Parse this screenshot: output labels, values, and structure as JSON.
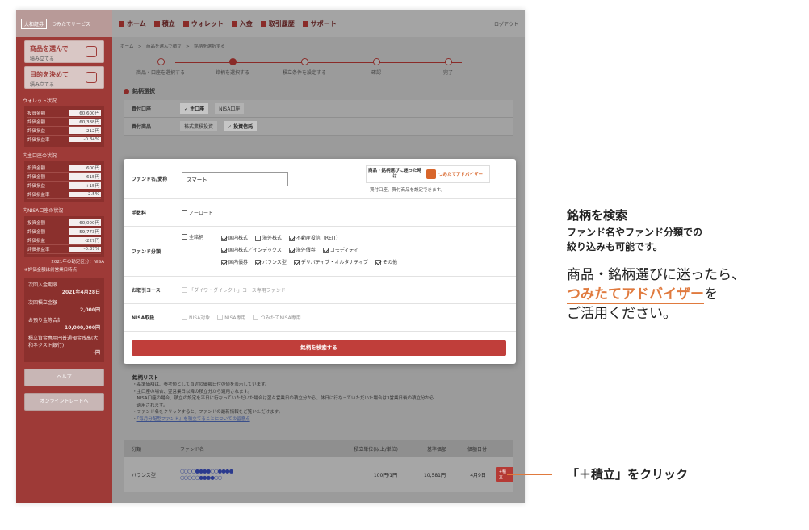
{
  "sidebar": {
    "logo_left": "大和証券",
    "logo_right": "つみたてサービス",
    "cards": [
      {
        "title": "商品を選んで",
        "sub": "積み立てる"
      },
      {
        "title": "目的を決めて",
        "sub": "積み立てる"
      }
    ],
    "wallet": {
      "title": "ウォレット状況",
      "rows": [
        {
          "label": "投資金額",
          "value": "60,600円"
        },
        {
          "label": "評価金額",
          "value": "60,388円"
        },
        {
          "label": "評価損益",
          "value": "-212円"
        },
        {
          "label": "評価損益率",
          "value": "-0.34%"
        }
      ]
    },
    "domestic": {
      "title": "内主口座の状況",
      "rows": [
        {
          "label": "投資金額",
          "value": "600円"
        },
        {
          "label": "評価金額",
          "value": "615円"
        },
        {
          "label": "評価損益",
          "value": "+15円"
        },
        {
          "label": "評価損益率",
          "value": "+2.5%"
        }
      ]
    },
    "nisa": {
      "title": "内NISA口座の状況",
      "rows": [
        {
          "label": "投資金額",
          "value": "60,000円"
        },
        {
          "label": "評価金額",
          "value": "59,773円"
        },
        {
          "label": "評価損益",
          "value": "-227円"
        },
        {
          "label": "評価損益率",
          "value": "-0.37%"
        }
      ]
    },
    "note1": "2021年の勘定区分：NISA",
    "note2": "※評価金額は前営業日時点",
    "info": {
      "next_label": "次回入金期限",
      "next_date": "2021年4月28日",
      "amount_label": "次回積立金額",
      "amount": "2,000円",
      "deposit_label": "お預り金等合計",
      "deposit": "10,000,000円",
      "mrf_label": "積立資金専用円普通預金残高(大和ネクスト銀行)",
      "mrf": "-円"
    },
    "help": "ヘルプ",
    "online": "オンライントレードへ"
  },
  "nav": {
    "items": [
      "ホーム",
      "積立",
      "ウォレット",
      "入金",
      "取引履歴",
      "サポート"
    ],
    "logout": "ログアウト"
  },
  "breadcrumb": "ホーム　>　商品を選んで積立　>　銘柄を選択する",
  "steps": [
    "商品・口座を選択する",
    "銘柄を選択する",
    "積立条件を設定する",
    "確認",
    "完了"
  ],
  "section_title": "銘柄選択",
  "account": {
    "label": "買付口座",
    "options": [
      "主口座",
      "NISA口座"
    ]
  },
  "product": {
    "label": "買付商品",
    "options": [
      "株式業積投資",
      "投資信託"
    ]
  },
  "modal": {
    "fund_label": "ファンド名/愛称",
    "fund_value": "スマート",
    "banner_left": "商品・銘柄選びに迷った時は",
    "banner_right": "つみたてアドバイザー",
    "banner_note": "買付口座、買付商品を設定できます。",
    "fee_label": "手数料",
    "fee_option": "ノーロード",
    "category_label": "ファンド分類",
    "category_all": "全銘柄",
    "categories": [
      {
        "label": "国内株式",
        "checked": true
      },
      {
        "label": "海外株式",
        "checked": false
      },
      {
        "label": "不動産投信（REIT）",
        "checked": true
      },
      {
        "label": "国内株式／インデックス",
        "checked": true
      },
      {
        "label": "海外債券",
        "checked": true
      },
      {
        "label": "コモディティ",
        "checked": true
      },
      {
        "label": "国内債券",
        "checked": true
      },
      {
        "label": "バランス型",
        "checked": true
      },
      {
        "label": "デリバティブ・オルタナティブ",
        "checked": true
      },
      {
        "label": "その他",
        "checked": true
      }
    ],
    "course_label": "お取引コース",
    "course_option": "「ダイワ・ダイレクト」コース専用ファンド",
    "nisa_label": "NISA取扱",
    "nisa_options": [
      "NISA対象",
      "NISA専用",
      "つみたてNISA専用"
    ],
    "search_button": "銘柄を検索する"
  },
  "list": {
    "title": "銘柄リスト",
    "notes": [
      "・基準価額は、参考値として直近の価額日付の値を表示しています。",
      "・主口座の場合、翌営業日以降の積立分から適用されます。",
      "　NISA口座の場合、積立の設定を平日に行なっていただいた場合は翌々営業日の積立分から、休日に行なっていただいた場合は3営業日後の積立分から",
      "　適用されます。",
      "・ファンド名をクリックすると、ファンドの最新情報をご覧いただけます。"
    ],
    "link_prefix": "・",
    "link": "『毎月分配型ファンド』を積立てることについての留意点",
    "headers": [
      "分類",
      "ファンド名",
      "積立単位(以上/単位)",
      "基準価額",
      "価額日付"
    ],
    "rows": [
      {
        "category": "バランス型",
        "name_line1": "○○○○●●●●○○●●●●",
        "name_line2": "○○○○○●●●●○○",
        "unit": "100円/1円",
        "price": "10,581円",
        "date": "4月9日",
        "button": "+積立"
      }
    ]
  },
  "annotations": {
    "title": "銘柄を検索",
    "sub1": "ファンド名やファンド分類での",
    "sub2": "絞り込みも可能です。",
    "p1": "商品・銘柄選びに迷ったら、",
    "p2_highlight": "つみたてアドバイザー",
    "p2_rest": "を",
    "p3": "ご活用ください。",
    "click": "「＋積立」をクリック"
  }
}
